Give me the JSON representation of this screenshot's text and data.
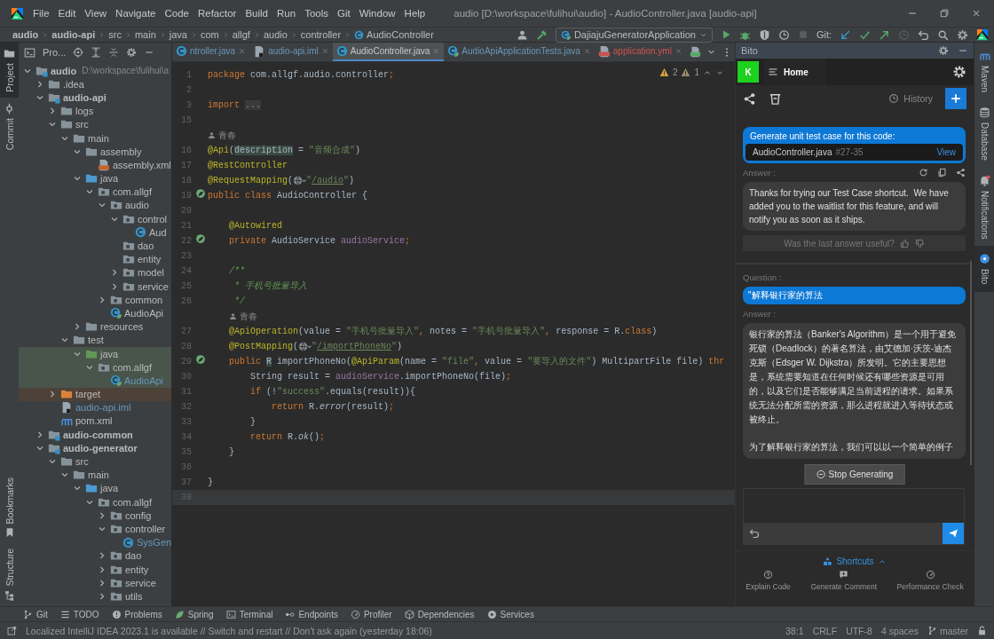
{
  "title_bar": {
    "menu": [
      "File",
      "Edit",
      "View",
      "Navigate",
      "Code",
      "Refactor",
      "Build",
      "Run",
      "Tools",
      "Git",
      "Window",
      "Help"
    ],
    "title": "audio [D:\\workspace\\fulihui\\audio] - AudioController.java [audio-api]"
  },
  "nav_bar": {
    "breadcrumbs": [
      {
        "label": "audio",
        "kind": "module"
      },
      {
        "label": "audio-api",
        "kind": "module"
      },
      {
        "label": "src",
        "kind": "folder"
      },
      {
        "label": "main",
        "kind": "folder"
      },
      {
        "label": "java",
        "kind": "folder"
      },
      {
        "label": "com",
        "kind": "folder"
      },
      {
        "label": "allgf",
        "kind": "folder"
      },
      {
        "label": "audio",
        "kind": "folder"
      },
      {
        "label": "controller",
        "kind": "folder"
      },
      {
        "label": "AudioController",
        "kind": "class"
      }
    ],
    "run_config": "DajiajuGeneratorApplication",
    "git_label": "Git:"
  },
  "left_stripe": {
    "top": [
      {
        "label": "Project",
        "kind": "project",
        "selected": true
      },
      {
        "label": "Commit",
        "kind": "commit",
        "selected": false
      }
    ],
    "bottom": [
      {
        "label": "Bookmarks",
        "kind": "bookmarks",
        "selected": false
      },
      {
        "label": "Structure",
        "kind": "structure",
        "selected": false
      }
    ]
  },
  "project": {
    "title": "Pro...",
    "tree": [
      {
        "label": "audio",
        "kind": "module",
        "path": "D:\\workspace\\fulihui\\a",
        "expanded": true,
        "children": [
          {
            "label": ".idea",
            "kind": "folder",
            "expanded": false
          },
          {
            "label": "audio-api",
            "kind": "module",
            "expanded": true,
            "children": [
              {
                "label": "logs",
                "kind": "folder",
                "expanded": false
              },
              {
                "label": "src",
                "kind": "folder",
                "expanded": true,
                "children": [
                  {
                    "label": "main",
                    "kind": "folder",
                    "expanded": true,
                    "children": [
                      {
                        "label": "assembly",
                        "kind": "folder",
                        "expanded": true,
                        "children": [
                          {
                            "label": "assembly.xml",
                            "kind": "xml"
                          }
                        ]
                      },
                      {
                        "label": "java",
                        "kind": "source",
                        "expanded": true,
                        "children": [
                          {
                            "label": "com.allgf",
                            "kind": "package",
                            "expanded": true,
                            "children": [
                              {
                                "label": "audio",
                                "kind": "package",
                                "expanded": true,
                                "children": [
                                  {
                                    "label": "control",
                                    "kind": "package",
                                    "expanded": true,
                                    "children": [
                                      {
                                        "label": "Aud",
                                        "kind": "class"
                                      }
                                    ]
                                  },
                                  {
                                    "label": "dao",
                                    "kind": "package"
                                  },
                                  {
                                    "label": "entity",
                                    "kind": "package"
                                  },
                                  {
                                    "label": "model",
                                    "kind": "package",
                                    "expanded": false
                                  },
                                  {
                                    "label": "service",
                                    "kind": "package",
                                    "expanded": false
                                  }
                                ]
                              },
                              {
                                "label": "common",
                                "kind": "package",
                                "expanded": false
                              },
                              {
                                "label": "AudioApi",
                                "kind": "spring-class"
                              }
                            ]
                          }
                        ]
                      },
                      {
                        "label": "resources",
                        "kind": "folder",
                        "expanded": false
                      }
                    ]
                  },
                  {
                    "label": "test",
                    "kind": "folder",
                    "expanded": true,
                    "children": [
                      {
                        "label": "java",
                        "kind": "test-source",
                        "test": true,
                        "expanded": true,
                        "children": [
                          {
                            "label": "com.allgf",
                            "kind": "package",
                            "test": true,
                            "expanded": true,
                            "children": [
                              {
                                "label": "AudioApi",
                                "kind": "spring-class",
                                "test": true,
                                "modified": true
                              }
                            ]
                          }
                        ]
                      }
                    ]
                  }
                ]
              },
              {
                "label": "target",
                "kind": "excluded",
                "expanded": false
              },
              {
                "label": "audio-api.iml",
                "kind": "iml",
                "modified": true
              },
              {
                "label": "pom.xml",
                "kind": "maven"
              }
            ]
          },
          {
            "label": "audio-common",
            "kind": "module",
            "expanded": false
          },
          {
            "label": "audio-generator",
            "kind": "module",
            "expanded": true,
            "children": [
              {
                "label": "src",
                "kind": "folder",
                "expanded": true,
                "children": [
                  {
                    "label": "main",
                    "kind": "folder",
                    "expanded": true,
                    "children": [
                      {
                        "label": "java",
                        "kind": "source",
                        "expanded": true,
                        "children": [
                          {
                            "label": "com.allgf",
                            "kind": "package",
                            "expanded": true,
                            "children": [
                              {
                                "label": "config",
                                "kind": "package",
                                "expanded": false
                              },
                              {
                                "label": "controller",
                                "kind": "package",
                                "expanded": true,
                                "children": [
                                  {
                                    "label": "SysGen",
                                    "kind": "class",
                                    "modified": true
                                  }
                                ]
                              },
                              {
                                "label": "dao",
                                "kind": "package",
                                "expanded": false
                              },
                              {
                                "label": "entity",
                                "kind": "package",
                                "expanded": false
                              },
                              {
                                "label": "service",
                                "kind": "package",
                                "expanded": false
                              },
                              {
                                "label": "utils",
                                "kind": "package",
                                "expanded": false
                              }
                            ]
                          }
                        ]
                      }
                    ]
                  }
                ]
              }
            ]
          }
        ]
      }
    ]
  },
  "editor": {
    "tabs": [
      {
        "label": "ntroller.java",
        "kind": "class",
        "modified": true,
        "error": false,
        "selected": false
      },
      {
        "label": "audio-api.iml",
        "kind": "iml",
        "modified": true,
        "error": false,
        "selected": false
      },
      {
        "label": "AudioController.java",
        "kind": "class",
        "modified": false,
        "error": false,
        "selected": true
      },
      {
        "label": "AudioApiApplicationTests.java",
        "kind": "spring-class",
        "modified": true,
        "error": false,
        "selected": false
      },
      {
        "label": "application.yml",
        "kind": "yml",
        "modified": false,
        "error": true,
        "selected": false
      }
    ],
    "warnings": "2",
    "weak_warnings": "1",
    "lines": [
      {
        "kind": "code",
        "no": "1",
        "tokens": [
          {
            "t": "package",
            "kind": "kw"
          },
          {
            "t": " com.allgf.audio.controller",
            "kind": "plain"
          },
          {
            "t": ";",
            "kind": "kw"
          }
        ]
      },
      {
        "kind": "code",
        "no": "2"
      },
      {
        "kind": "code",
        "no": "3",
        "tokens": [
          {
            "t": "import ",
            "kind": "kw"
          },
          {
            "t": "...",
            "kind": "fold"
          }
        ]
      },
      {
        "kind": "code",
        "no": "15"
      },
      {
        "kind": "class-author",
        "text": "青春"
      },
      {
        "kind": "code",
        "no": "16",
        "tokens": [
          {
            "t": "@Api",
            "kind": "ann"
          },
          {
            "t": "(",
            "kind": "plain"
          },
          {
            "t": "description",
            "kind": "hl"
          },
          {
            "t": " = ",
            "kind": "plain"
          },
          {
            "t": "\"音频合成\"",
            "kind": "str"
          },
          {
            "t": ")",
            "kind": "plain"
          }
        ]
      },
      {
        "kind": "code",
        "no": "17",
        "tokens": [
          {
            "t": "@RestController",
            "kind": "ann"
          }
        ]
      },
      {
        "kind": "code",
        "no": "18",
        "tokens": [
          {
            "t": "@RequestMapping",
            "kind": "ann"
          },
          {
            "t": "(",
            "kind": "plain"
          },
          {
            "kind": "globe"
          },
          {
            "t": "\"",
            "kind": "str"
          },
          {
            "t": "/audio",
            "kind": "link"
          },
          {
            "t": "\"",
            "kind": "str"
          },
          {
            "t": ")",
            "kind": "plain"
          }
        ]
      },
      {
        "kind": "code",
        "no": "19",
        "run_marker": true,
        "tokens": [
          {
            "t": "public class ",
            "kind": "kw"
          },
          {
            "t": "AudioController {",
            "kind": "plain"
          }
        ]
      },
      {
        "kind": "code",
        "no": "20"
      },
      {
        "kind": "code",
        "no": "21",
        "tokens": [
          {
            "t": "    @Autowired",
            "kind": "ann"
          }
        ]
      },
      {
        "kind": "code",
        "no": "22",
        "run_marker": true,
        "tokens": [
          {
            "t": "    private ",
            "kind": "kw"
          },
          {
            "t": "AudioService ",
            "kind": "plain"
          },
          {
            "t": "audioService",
            "kind": "fld"
          },
          {
            "t": ";",
            "kind": "kw"
          }
        ]
      },
      {
        "kind": "code",
        "no": "23"
      },
      {
        "kind": "code",
        "no": "24",
        "tokens": [
          {
            "t": "    /**",
            "kind": "cmt"
          }
        ]
      },
      {
        "kind": "code",
        "no": "25",
        "tokens": [
          {
            "t": "     * 手机号批量导入",
            "kind": "cmt"
          }
        ]
      },
      {
        "kind": "code",
        "no": "26",
        "tokens": [
          {
            "t": "     */",
            "kind": "cmt"
          }
        ]
      },
      {
        "kind": "member-author",
        "text": "青春"
      },
      {
        "kind": "code",
        "no": "27",
        "tokens": [
          {
            "t": "    @ApiOperation",
            "kind": "ann"
          },
          {
            "t": "(value = ",
            "kind": "plain"
          },
          {
            "t": "\"手机号批量导入\"",
            "kind": "str"
          },
          {
            "t": ", ",
            "kind": "kw"
          },
          {
            "t": "notes = ",
            "kind": "plain"
          },
          {
            "t": "\"手机号批量导入\"",
            "kind": "str"
          },
          {
            "t": ", ",
            "kind": "kw"
          },
          {
            "t": "response = R.",
            "kind": "plain"
          },
          {
            "t": "class",
            "kind": "kw"
          },
          {
            "t": ")",
            "kind": "plain"
          }
        ]
      },
      {
        "kind": "code",
        "no": "28",
        "tokens": [
          {
            "t": "    @PostMapping",
            "kind": "ann"
          },
          {
            "t": "(",
            "kind": "plain"
          },
          {
            "kind": "globe"
          },
          {
            "t": "\"",
            "kind": "str"
          },
          {
            "t": "/importPhoneNo",
            "kind": "link"
          },
          {
            "t": "\"",
            "kind": "str"
          },
          {
            "t": ")",
            "kind": "plain"
          }
        ]
      },
      {
        "kind": "code",
        "no": "29",
        "run_marker": true,
        "tokens": [
          {
            "t": "    public ",
            "kind": "kw"
          },
          {
            "t": "R",
            "kind": "hl"
          },
          {
            "t": " importPhoneNo(",
            "kind": "plain"
          },
          {
            "t": "@ApiParam",
            "kind": "ann"
          },
          {
            "t": "(name = ",
            "kind": "plain"
          },
          {
            "t": "\"file\"",
            "kind": "str"
          },
          {
            "t": ", ",
            "kind": "kw"
          },
          {
            "t": "value = ",
            "kind": "plain"
          },
          {
            "t": "\"要导入的文件\"",
            "kind": "str"
          },
          {
            "t": ") MultipartFile file) ",
            "kind": "plain"
          },
          {
            "t": "thr",
            "kind": "kw"
          }
        ]
      },
      {
        "kind": "code",
        "no": "30",
        "tokens": [
          {
            "t": "        String result = ",
            "kind": "plain"
          },
          {
            "t": "audioService",
            "kind": "fld"
          },
          {
            "t": ".importPhoneNo(file)",
            "kind": "plain"
          },
          {
            "t": ";",
            "kind": "kw"
          }
        ]
      },
      {
        "kind": "code",
        "no": "31",
        "tokens": [
          {
            "t": "        if ",
            "kind": "kw"
          },
          {
            "t": "(!",
            "kind": "plain"
          },
          {
            "t": "\"success\"",
            "kind": "str"
          },
          {
            "t": ".equals(result)){",
            "kind": "plain"
          }
        ]
      },
      {
        "kind": "code",
        "no": "32",
        "tokens": [
          {
            "t": "            return ",
            "kind": "kw"
          },
          {
            "t": "R.",
            "kind": "plain"
          },
          {
            "t": "error",
            "kind": "it"
          },
          {
            "t": "(result)",
            "kind": "plain"
          },
          {
            "t": ";",
            "kind": "kw"
          }
        ]
      },
      {
        "kind": "code",
        "no": "33",
        "tokens": [
          {
            "t": "        }",
            "kind": "plain"
          }
        ]
      },
      {
        "kind": "code",
        "no": "34",
        "tokens": [
          {
            "t": "        return ",
            "kind": "kw"
          },
          {
            "t": "R.",
            "kind": "plain"
          },
          {
            "t": "ok",
            "kind": "it"
          },
          {
            "t": "()",
            "kind": "plain"
          },
          {
            "t": ";",
            "kind": "kw"
          }
        ]
      },
      {
        "kind": "code",
        "no": "35",
        "tokens": [
          {
            "t": "    }",
            "kind": "plain"
          }
        ]
      },
      {
        "kind": "code",
        "no": "36"
      },
      {
        "kind": "code",
        "no": "37",
        "tokens": [
          {
            "t": "}",
            "kind": "plain"
          }
        ]
      },
      {
        "kind": "code",
        "no": "38",
        "current": true
      }
    ]
  },
  "bito": {
    "title": "Bito",
    "avatar": "K",
    "home_tab": "Home",
    "history": "History",
    "conversation": [
      {
        "kind": "question",
        "text": "Generate unit test case for this code:",
        "file": "AudioController.java",
        "range": "#27-35",
        "action": "View"
      },
      {
        "kind": "answer",
        "label": "Answer :",
        "toolbar": true,
        "paragraphs": [
          "Thanks for trying our Test Case shortcut.  We have added you to the waitlist for this feature, and will notify you as soon as it ships."
        ]
      },
      {
        "kind": "feedback",
        "text": "Was the last answer useful?"
      },
      {
        "kind": "question",
        "label": "Question :",
        "text": "\"解释银行家的算法"
      },
      {
        "kind": "answer",
        "label": "Answer :",
        "paragraphs": [
          "银行家的算法（Banker's Algorithm）是一个用于避免死锁（Deadlock）的著名算法，由艾德加·沃茨-迪杰克斯（Edsger W. Dijkstra）所发明。它的主要思想是，系统需要知道在任何时候还有哪些资源是可用的，以及它们是否能够满足当前进程的请求。如果系统无法分配所需的资源，那么进程就进入等待状态或被终止。",
          "为了解释银行家的算法，我们可以以一个简单的例子"
        ]
      }
    ],
    "stop_button": "Stop Generating",
    "shortcuts_label": "Shortcuts",
    "shortcuts": [
      {
        "label": "Explain Code",
        "kind": "explain"
      },
      {
        "label": "Generate Comment",
        "kind": "comment"
      },
      {
        "label": "Performance Check",
        "kind": "performance"
      }
    ]
  },
  "right_stripe": [
    {
      "label": "Maven",
      "kind": "maven",
      "selected": false
    },
    {
      "label": "Database",
      "kind": "database",
      "selected": false
    },
    {
      "label": "Notifications",
      "kind": "notifications",
      "selected": false
    },
    {
      "label": "Bito",
      "kind": "bito",
      "selected": true
    }
  ],
  "tool_strip": [
    {
      "label": "Git",
      "kind": "git"
    },
    {
      "label": "TODO",
      "kind": "todo"
    },
    {
      "label": "Problems",
      "kind": "problems"
    },
    {
      "label": "Spring",
      "kind": "spring"
    },
    {
      "label": "Terminal",
      "kind": "terminal"
    },
    {
      "label": "Endpoints",
      "kind": "endpoints"
    },
    {
      "label": "Profiler",
      "kind": "profiler"
    },
    {
      "label": "Dependencies",
      "kind": "dependencies"
    },
    {
      "label": "Services",
      "kind": "services"
    }
  ],
  "status_bar": {
    "message": "Localized IntelliJ IDEA 2023.1 is available // Switch and restart // Don't ask again (yesterday 18:06)",
    "position": "38:1",
    "line_ending": "CRLF",
    "encoding": "UTF-8",
    "indent": "4 spaces",
    "branch": "master"
  }
}
